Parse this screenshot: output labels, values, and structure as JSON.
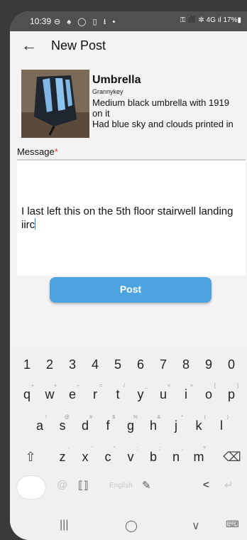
{
  "status": {
    "time": "10:39",
    "left_icons": "⊖ ♠ ◯ ▯ ⭳ •",
    "right_icons": "⚿ ⬛ ✲ 4G ıl 17%▮"
  },
  "appbar": {
    "back_icon": "←",
    "title": "New Post"
  },
  "item": {
    "name": "Umbrella",
    "user": "Grannykey",
    "description": "Medium black umbrella with 1919\non it\nHad blue sky and clouds printed in"
  },
  "message": {
    "label": "Message",
    "required_mark": "*",
    "value": "I last left this on the 5th floor stairwell landing iirc"
  },
  "post_button": "Post",
  "keyboard": {
    "number_row": [
      "1",
      "2",
      "3",
      "4",
      "5",
      "6",
      "7",
      "8",
      "9",
      "0"
    ],
    "row1": [
      [
        "q",
        "+"
      ],
      [
        "w",
        "×"
      ],
      [
        "e",
        "÷"
      ],
      [
        "r",
        "="
      ],
      [
        "t",
        "/"
      ],
      [
        "y",
        "_"
      ],
      [
        "u",
        "<"
      ],
      [
        "i",
        ">"
      ],
      [
        "o",
        "["
      ],
      [
        "p",
        "]"
      ]
    ],
    "row2": [
      [
        "a",
        "!"
      ],
      [
        "s",
        "@"
      ],
      [
        "d",
        "#"
      ],
      [
        "f",
        "$"
      ],
      [
        "g",
        "%"
      ],
      [
        "h",
        "&"
      ],
      [
        "j",
        "*"
      ],
      [
        "k",
        "("
      ],
      [
        "l",
        ")"
      ]
    ],
    "row3": [
      [
        "z",
        "-"
      ],
      [
        "x",
        "'"
      ],
      [
        "c",
        "\""
      ],
      [
        "v",
        ":"
      ],
      [
        "b",
        ";"
      ],
      [
        "n",
        ","
      ],
      [
        "m",
        "?"
      ]
    ],
    "shift_icon": "⇧",
    "backspace_icon": "⌫",
    "toolbar": {
      "at_icon": "@",
      "scan_icon": "⟦⟧",
      "language": "English",
      "handwriting_icon": "✎",
      "share_icon": "<",
      "enter_icon": "↵"
    }
  },
  "navbar": {
    "recents_icon": "|||",
    "home_icon": "◯",
    "back_icon": "∨",
    "keyboard_icon": "⌨"
  }
}
